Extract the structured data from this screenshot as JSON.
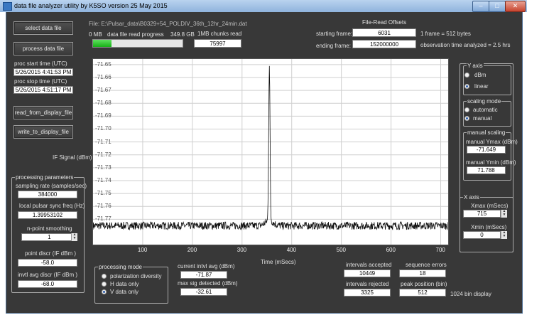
{
  "window": {
    "title": "data file analyzer utility    by K5SO       version 25 May 2015"
  },
  "buttons": {
    "select": "select data file",
    "process": "process data file",
    "read_display": "read_from_display_file",
    "write_display": "write_to_display_file"
  },
  "file": {
    "path": "File: E:\\Pulsar_data\\B0329+54_POLDIV_36th_12hr_24min.dat"
  },
  "progress": {
    "start_label": "0 MB",
    "label": "data file read progress",
    "end_label": "349.8 GB",
    "fraction": 0.21
  },
  "chunks": {
    "label": "1MB chunks read",
    "value": "75997"
  },
  "offsets": {
    "title": "File-Read Offsets",
    "start_label": "starting frame:",
    "start_value": "6031",
    "end_label": "ending frame:",
    "end_value": "152000000",
    "frame_note": "1 frame = 512 bytes",
    "obs_note": "observation time analyzed = 2.5  hrs"
  },
  "proc_times": {
    "start_label": "proc start time (UTC)",
    "start_value": "5/26/2015 4:41:53 PM",
    "stop_label": "proc stop time (UTC)",
    "stop_value": "5/26/2015 4:51:17 PM"
  },
  "processing_params": {
    "title": "processing parameters",
    "sampling_label": "sampling rate (samples/sec)",
    "sampling_value": "384000",
    "sync_label": "local pulsar sync freq (Hz)",
    "sync_value": "1.39953102",
    "smoothing_label": "n-point smoothing",
    "smoothing_value": "1",
    "point_discr_label": "point discr (IF dBm )",
    "point_discr_value": "-58.0",
    "invtl_discr_label": "invtl avg discr (IF dBm )",
    "invtl_discr_value": "-68.0"
  },
  "processing_mode": {
    "title": "processing mode",
    "options": [
      "polarization diversity",
      "H data only",
      "V data only"
    ],
    "selected": 2
  },
  "y_axis": {
    "title": "Y axis",
    "options": [
      "dBm",
      "linear"
    ],
    "selected": 1
  },
  "scaling_mode": {
    "title": "scaling mode",
    "options": [
      "automatic",
      "manual"
    ],
    "selected": 1
  },
  "manual_scaling": {
    "title": "manual scaling",
    "ymax_label": "manual Ymax (dBm)",
    "ymax_value": "-71.649",
    "ymin_label": "manual Ymin (dBm)",
    "ymin_value": "71.788"
  },
  "x_axis": {
    "title": "X axis",
    "xmax_label": "Xmax (mSecs)",
    "xmax_value": "715",
    "xmin_label": "Xmin (mSecs)",
    "xmin_value": "0"
  },
  "stats": {
    "current_label": "current intvl avg (dBm)",
    "current_value": "-71.87",
    "maxsig_label": "max sig  detected (dBm)",
    "maxsig_value": "-32.61",
    "accepted_label": "intervals accepted",
    "accepted_value": "10449",
    "rejected_label": "intervals rejected",
    "rejected_value": "3325",
    "seqerr_label": "sequence errors",
    "seqerr_value": "18",
    "peak_label": "peak position (bin)",
    "peak_value": "512",
    "bin_note": "1024 bin display"
  },
  "chart_data": {
    "type": "line",
    "ylabel": "IF Signal (dBm)",
    "xlabel": "Time (mSecs)",
    "xlim": [
      0,
      715
    ],
    "ylim": [
      -71.788,
      -71.649
    ],
    "x_ticks": [
      100,
      200,
      300,
      400,
      500,
      600,
      700
    ],
    "y_ticks": [
      "-71.65",
      "-71.66",
      "-71.67",
      "-71.68",
      "-71.69",
      "-71.70",
      "-71.71",
      "-71.72",
      "-71.73",
      "-71.74",
      "-71.75",
      "-71.76",
      "-71.77"
    ],
    "series": [
      {
        "baseline": -71.775,
        "noise_amplitude": 0.003,
        "peak_x": 355,
        "peak_y": -71.654,
        "samples": [
          {
            "x": 0,
            "y": -71.776
          },
          {
            "x": 50,
            "y": -71.775
          },
          {
            "x": 100,
            "y": -71.776
          },
          {
            "x": 150,
            "y": -71.775
          },
          {
            "x": 200,
            "y": -71.776
          },
          {
            "x": 250,
            "y": -71.775
          },
          {
            "x": 300,
            "y": -71.775
          },
          {
            "x": 330,
            "y": -71.774
          },
          {
            "x": 345,
            "y": -71.772
          },
          {
            "x": 350,
            "y": -71.765
          },
          {
            "x": 353,
            "y": -71.72
          },
          {
            "x": 355,
            "y": -71.654
          },
          {
            "x": 357,
            "y": -71.7
          },
          {
            "x": 360,
            "y": -71.752
          },
          {
            "x": 365,
            "y": -71.772
          },
          {
            "x": 380,
            "y": -71.775
          },
          {
            "x": 400,
            "y": -71.775
          },
          {
            "x": 450,
            "y": -71.776
          },
          {
            "x": 500,
            "y": -71.775
          },
          {
            "x": 550,
            "y": -71.776
          },
          {
            "x": 600,
            "y": -71.775
          },
          {
            "x": 650,
            "y": -71.776
          },
          {
            "x": 715,
            "y": -71.775
          }
        ]
      }
    ]
  }
}
